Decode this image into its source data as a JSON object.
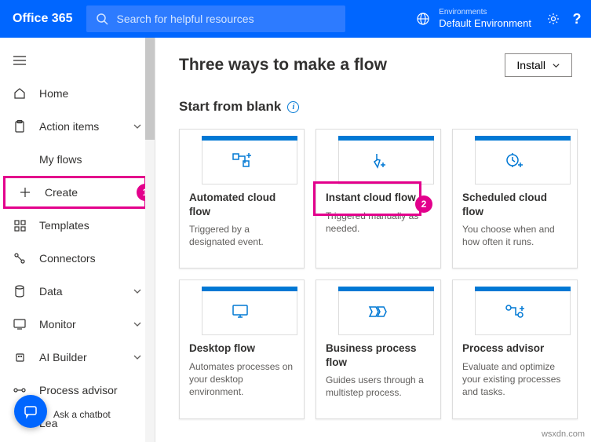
{
  "header": {
    "brand": "Office 365",
    "search_placeholder": "Search for helpful resources",
    "env_label": "Environments",
    "env_name": "Default Environment"
  },
  "sidebar": {
    "items": [
      {
        "label": "Home"
      },
      {
        "label": "Action items",
        "chevron": true
      },
      {
        "label": "My flows"
      },
      {
        "label": "Create",
        "highlight": true,
        "badge": "1"
      },
      {
        "label": "Templates"
      },
      {
        "label": "Connectors"
      },
      {
        "label": "Data",
        "chevron": true
      },
      {
        "label": "Monitor",
        "chevron": true
      },
      {
        "label": "AI Builder",
        "chevron": true
      },
      {
        "label": "Process advisor"
      },
      {
        "label": "Lea"
      }
    ],
    "chatbot": "Ask a chatbot"
  },
  "main": {
    "title": "Three ways to make a flow",
    "install": "Install",
    "subtitle": "Start from blank",
    "cards": [
      {
        "title": "Automated cloud flow",
        "desc": "Triggered by a designated event."
      },
      {
        "title": "Instant cloud flow",
        "desc": "Triggered manually as needed.",
        "highlight": true,
        "badge": "2"
      },
      {
        "title": "Scheduled cloud flow",
        "desc": "You choose when and how often it runs."
      },
      {
        "title": "Desktop flow",
        "desc": "Automates processes on your desktop environment."
      },
      {
        "title": "Business process flow",
        "desc": "Guides users through a multistep process."
      },
      {
        "title": "Process advisor",
        "desc": "Evaluate and optimize your existing processes and tasks."
      }
    ]
  },
  "watermark": "wsxdn.com"
}
